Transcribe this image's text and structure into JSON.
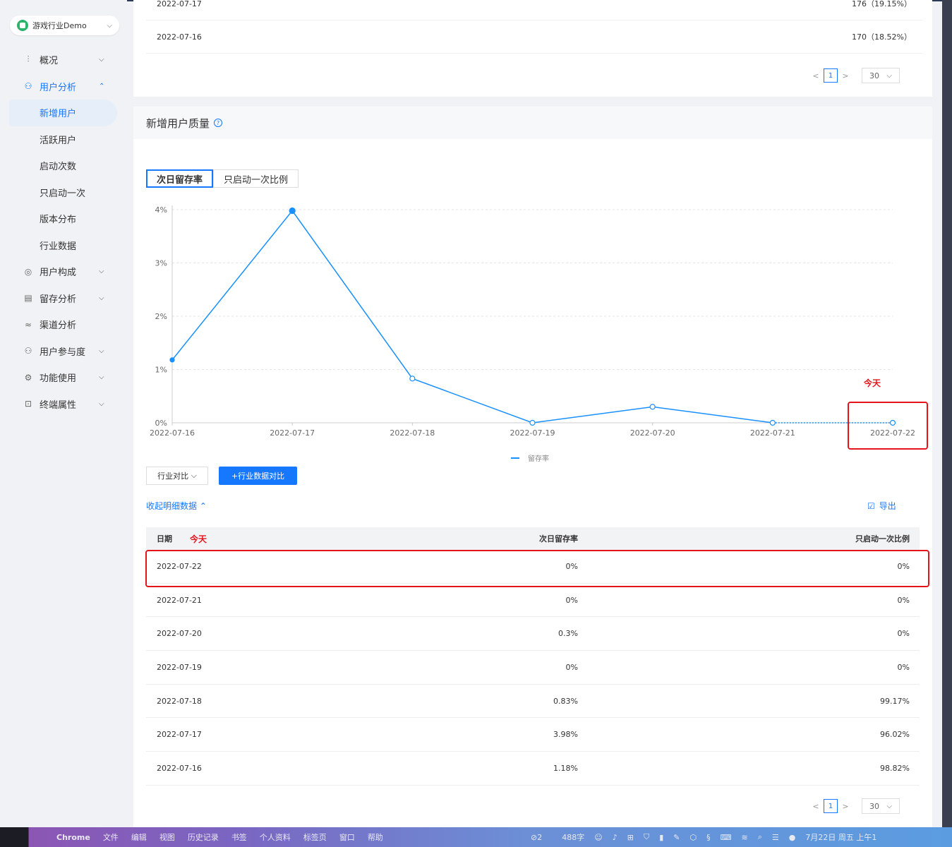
{
  "app_selector": {
    "name": "游戏行业Demo"
  },
  "nav": {
    "items": [
      {
        "label": "概况",
        "icon": "chart-icon",
        "glyph": "⫶"
      },
      {
        "label": "用户分析",
        "icon": "user-analysis-icon",
        "glyph": "⚇"
      },
      {
        "label": "用户构成",
        "icon": "user-compose-icon",
        "glyph": "◎"
      },
      {
        "label": "留存分析",
        "icon": "retention-icon",
        "glyph": "▤"
      },
      {
        "label": "渠道分析",
        "icon": "channel-icon",
        "glyph": "≈"
      },
      {
        "label": "用户参与度",
        "icon": "engagement-icon",
        "glyph": "⚇"
      },
      {
        "label": "功能使用",
        "icon": "feature-icon",
        "glyph": "⚙"
      },
      {
        "label": "终端属性",
        "icon": "device-icon",
        "glyph": "⊡"
      }
    ],
    "sub_items": [
      "新增用户",
      "活跃用户",
      "启动次数",
      "只启动一次",
      "版本分布",
      "行业数据"
    ]
  },
  "top_table": {
    "rows": [
      {
        "date": "2022-07-17",
        "value": "176（19.15%）"
      },
      {
        "date": "2022-07-16",
        "value": "170（18.52%）"
      }
    ]
  },
  "pagination": {
    "prev": "<",
    "next": ">",
    "page": "1",
    "page_size": "30"
  },
  "section": {
    "title": "新增用户质量",
    "tabs": [
      "次日留存率",
      "只启动一次比例"
    ],
    "compare_button": "行业对比",
    "add_compare_button": "+行业数据对比",
    "collapse_link": "收起明细数据",
    "export_button": "导出",
    "today_label": "今天"
  },
  "chart_data": {
    "type": "line",
    "x": [
      "2022-07-16",
      "2022-07-17",
      "2022-07-18",
      "2022-07-19",
      "2022-07-20",
      "2022-07-21",
      "2022-07-22"
    ],
    "series": [
      {
        "name": "留存率",
        "values": [
          1.18,
          3.98,
          0.83,
          0,
          0.3,
          0,
          0
        ]
      }
    ],
    "y_ticks": [
      "0%",
      "1%",
      "2%",
      "3%",
      "4%"
    ],
    "ylim": [
      0,
      4
    ],
    "grid": true,
    "legend": "bottom-center",
    "color": "#1890ff"
  },
  "detail_table": {
    "headers": [
      "日期",
      "次日留存率",
      "只启动一次比例"
    ],
    "rows": [
      {
        "date": "2022-07-22",
        "retention": "0%",
        "once": "0%"
      },
      {
        "date": "2022-07-21",
        "retention": "0%",
        "once": "0%"
      },
      {
        "date": "2022-07-20",
        "retention": "0.3%",
        "once": "0%"
      },
      {
        "date": "2022-07-19",
        "retention": "0%",
        "once": "0%"
      },
      {
        "date": "2022-07-18",
        "retention": "0.83%",
        "once": "99.17%"
      },
      {
        "date": "2022-07-17",
        "retention": "3.98%",
        "once": "96.02%"
      },
      {
        "date": "2022-07-16",
        "retention": "1.18%",
        "once": "98.82%"
      }
    ]
  },
  "taskbar": {
    "menus": [
      "Chrome",
      "文件",
      "编辑",
      "视图",
      "历史记录",
      "书签",
      "个人资料",
      "标签页",
      "窗口",
      "帮助"
    ],
    "tray_count": "2",
    "char_count": "488字",
    "datetime": "7月22日 周五 上午1"
  }
}
